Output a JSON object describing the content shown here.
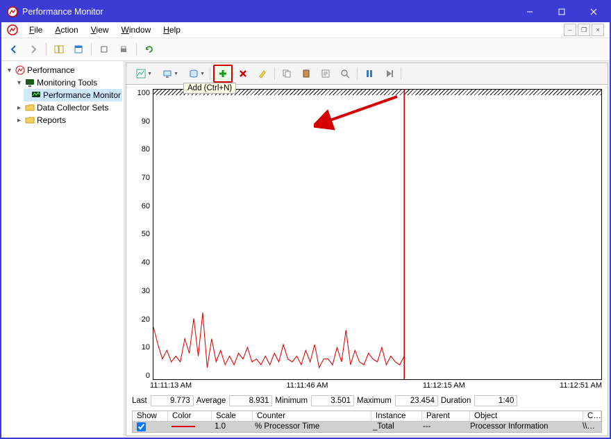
{
  "window": {
    "title": "Performance Monitor"
  },
  "menu": {
    "file": "File",
    "action": "Action",
    "view": "View",
    "window": "Window",
    "help": "Help"
  },
  "tree": {
    "root": "Performance",
    "monitoring": "Monitoring Tools",
    "perfmon": "Performance Monitor",
    "dcs": "Data Collector Sets",
    "reports": "Reports"
  },
  "tooltip": "Add (Ctrl+N)",
  "chart_data": {
    "type": "line",
    "ylim": [
      0,
      100
    ],
    "yticks": [
      100,
      90,
      80,
      70,
      60,
      50,
      40,
      30,
      20,
      10,
      0
    ],
    "xticks": [
      "11:11:13 AM",
      "11:11:46 AM",
      "11:12:15 AM",
      "11:12:51 AM"
    ],
    "cursor_pct": 56,
    "series": [
      {
        "name": "% Processor Time",
        "color": "#e00000",
        "values": [
          18,
          12,
          7,
          10,
          6,
          8,
          6,
          14,
          9,
          21,
          8,
          23,
          4,
          14,
          6,
          10,
          5,
          8,
          5,
          9,
          7,
          11,
          6,
          7,
          5,
          8,
          5,
          9,
          6,
          12,
          7,
          6,
          8,
          5,
          10,
          6,
          12,
          4,
          7,
          7,
          5,
          11,
          6,
          17,
          5,
          10,
          6,
          5,
          9,
          7,
          6,
          11,
          5,
          8,
          6,
          5,
          8
        ]
      }
    ]
  },
  "stats": {
    "last_label": "Last",
    "last": "9.773",
    "avg_label": "Average",
    "avg": "8.931",
    "min_label": "Minimum",
    "min": "3.501",
    "max_label": "Maximum",
    "max": "23.454",
    "dur_label": "Duration",
    "dur": "1:40"
  },
  "legend": {
    "headers": {
      "show": "Show",
      "color": "Color",
      "scale": "Scale",
      "counter": "Counter",
      "instance": "Instance",
      "parent": "Parent",
      "object": "Object",
      "computer": "Computer"
    },
    "row": {
      "scale": "1.0",
      "counter": "% Processor Time",
      "instance": "_Total",
      "parent": "---",
      "object": "Processor Information",
      "computer": "\\\\OSIRIS"
    }
  }
}
